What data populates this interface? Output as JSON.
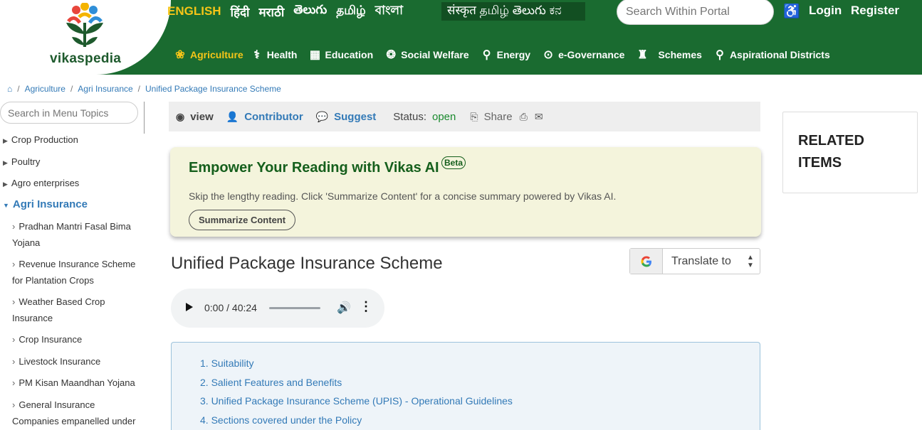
{
  "brand": {
    "logo_text": "vikaspedia"
  },
  "header": {
    "languages": [
      "ENGLISH",
      "हिंदी",
      "मराठी",
      "తెలుగు",
      "தமிழ்",
      "বাংলা"
    ],
    "script_ticker": "संस्कृत தமிழ் తెలుగు ಕನ",
    "search_placeholder": "Search Within Portal",
    "login": "Login",
    "register": "Register",
    "nav": [
      {
        "label": "Agriculture",
        "icon": "plant-icon"
      },
      {
        "label": "Health",
        "icon": "health-icon"
      },
      {
        "label": "Education",
        "icon": "education-icon"
      },
      {
        "label": "Social Welfare",
        "icon": "hands-icon"
      },
      {
        "label": "Energy",
        "icon": "wind-turbine-icon"
      },
      {
        "label": "e-Governance",
        "icon": "monitor-icon"
      },
      {
        "label": "Schemes",
        "icon": "emblem-icon"
      },
      {
        "label": "Aspirational Districts",
        "icon": "map-pin-icon"
      }
    ]
  },
  "breadcrumb": [
    "Agriculture",
    "Agri Insurance",
    "Unified Package Insurance Scheme"
  ],
  "sidebar": {
    "search_placeholder": "Search in Menu Topics",
    "top_items": [
      "Crop Production",
      "Poultry",
      "Agro enterprises"
    ],
    "expanded": "Agri Insurance",
    "children": [
      "Pradhan Mantri Fasal Bima Yojana",
      "Revenue Insurance Scheme for Plantation Crops",
      "Weather Based Crop Insurance",
      "Crop Insurance",
      "Livestock Insurance",
      "PM Kisan Maandhan Yojana",
      "General Insurance Companies empanelled under"
    ]
  },
  "toolbar": {
    "view": "view",
    "contributor": "Contributor",
    "suggest": "Suggest",
    "status_label": "Status:",
    "status_value": "open",
    "share": "Share"
  },
  "ai_card": {
    "title": "Empower Your Reading with Vikas AI",
    "badge": "Beta",
    "description": "Skip the lengthy reading. Click 'Summarize Content' for a concise summary powered by Vikas AI.",
    "button": "Summarize Content"
  },
  "article": {
    "title": "Unified Package Insurance Scheme",
    "translate_label": "Translate to",
    "audio_time": "0:00 / 40:24"
  },
  "toc": [
    "1. Suitability",
    "2. Salient Features and Benefits",
    "3. Unified Package Insurance Scheme (UPIS) - Operational Guidelines",
    "4. Sections covered under the Policy"
  ],
  "related": {
    "title": "RELATED ITEMS"
  },
  "colors": {
    "header_green": "#1a6b30",
    "accent_yellow": "#f5c518",
    "link_blue": "#337ab7",
    "ai_card_bg": "#f4f4dc"
  }
}
